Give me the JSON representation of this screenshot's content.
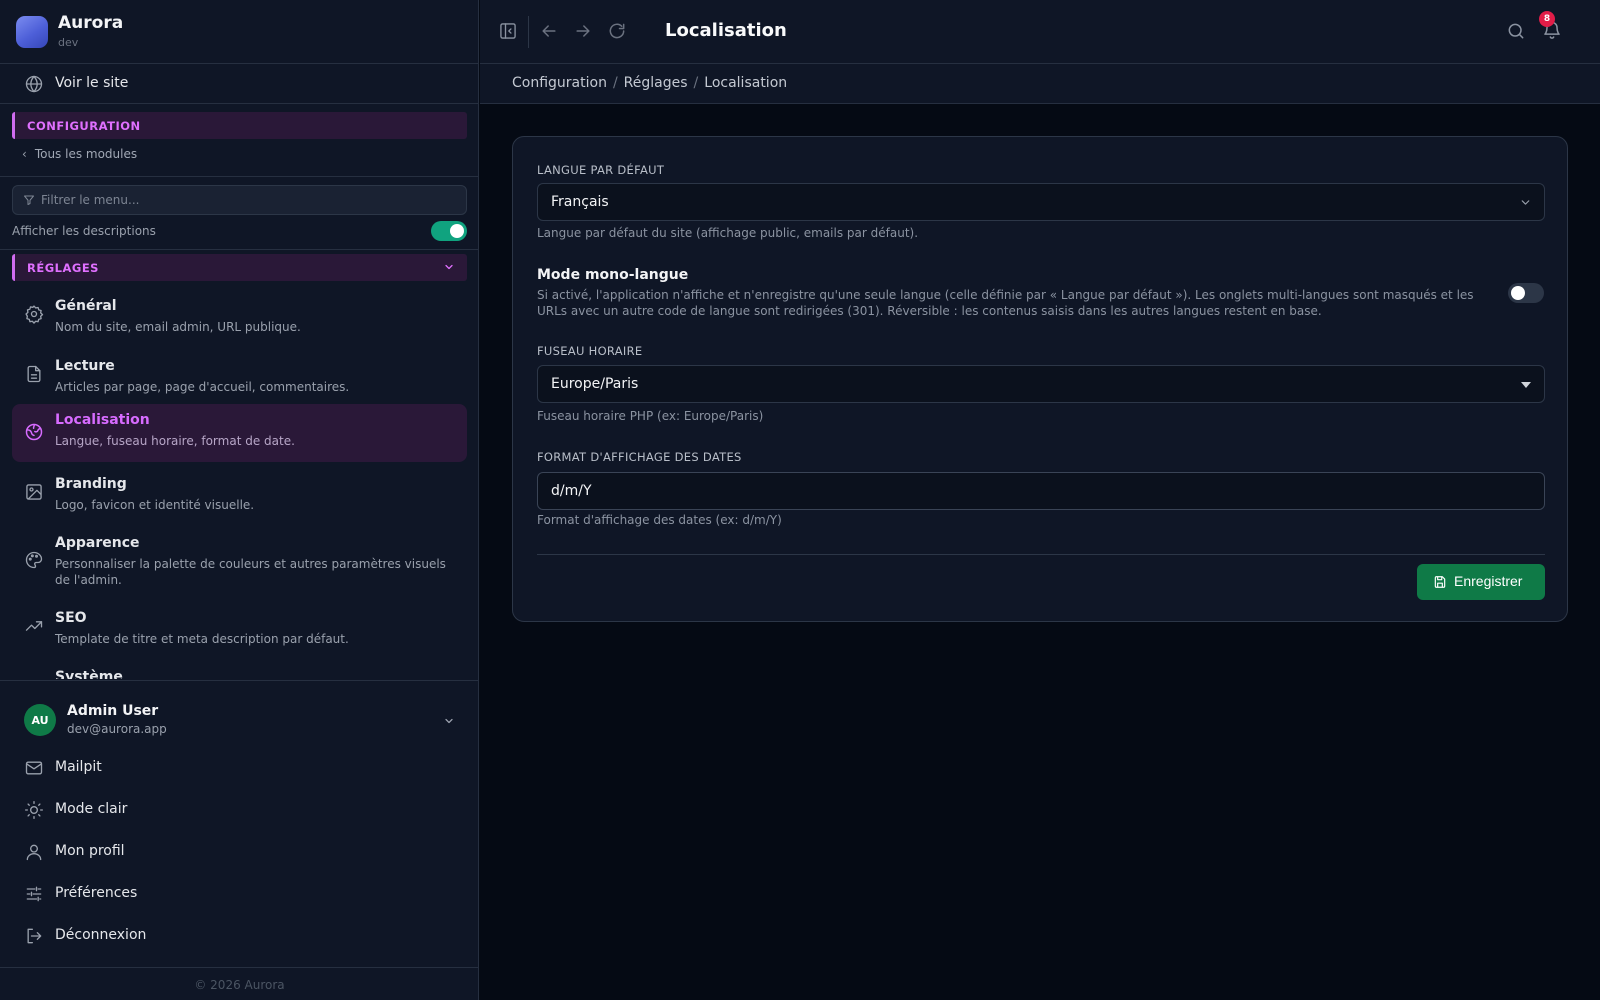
{
  "brand": {
    "name": "Aurora",
    "env": "dev"
  },
  "sidebar": {
    "view_site": "Voir le site",
    "section": "CONFIGURATION",
    "back": "Tous les modules",
    "filter_placeholder": "Filtrer le menu...",
    "show_descriptions_label": "Afficher les descriptions",
    "show_descriptions_on": true,
    "group": "RÉGLAGES",
    "items": [
      {
        "title": "Général",
        "desc": "Nom du site, email admin, URL publique.",
        "icon": "gear-icon"
      },
      {
        "title": "Lecture",
        "desc": "Articles par page, page d'accueil, commentaires.",
        "icon": "document-icon"
      },
      {
        "title": "Localisation",
        "desc": "Langue, fuseau horaire, format de date.",
        "icon": "globe-icon",
        "active": true
      },
      {
        "title": "Branding",
        "desc": "Logo, favicon et identité visuelle.",
        "icon": "image-icon"
      },
      {
        "title": "Apparence",
        "desc": "Personnaliser la palette de couleurs et autres paramètres visuels de l'admin.",
        "icon": "palette-icon"
      },
      {
        "title": "SEO",
        "desc": "Template de titre et meta description par défaut.",
        "icon": "trending-icon"
      },
      {
        "title": "Système",
        "desc": "",
        "icon": ""
      }
    ]
  },
  "user": {
    "initials": "AU",
    "name": "Admin User",
    "email": "dev@aurora.app"
  },
  "footer_links": [
    {
      "label": "Mailpit",
      "icon": "mail-icon"
    },
    {
      "label": "Mode clair",
      "icon": "sun-icon"
    },
    {
      "label": "Mon profil",
      "icon": "user-icon"
    },
    {
      "label": "Préférences",
      "icon": "sliders-icon"
    },
    {
      "label": "Déconnexion",
      "icon": "logout-icon"
    }
  ],
  "copyright": "© 2026 Aurora",
  "header": {
    "title": "Localisation",
    "notifications_count": "8"
  },
  "breadcrumb": [
    "Configuration",
    "Réglages",
    "Localisation"
  ],
  "form": {
    "default_language": {
      "label": "LANGUE PAR DÉFAUT",
      "value": "Français",
      "help": "Langue par défaut du site (affichage public, emails par défaut)."
    },
    "mono_language": {
      "title": "Mode mono-langue",
      "desc": "Si activé, l'application n'affiche et n'enregistre qu'une seule langue (celle définie par « Langue par défaut »). Les onglets multi-langues sont masqués et les URLs avec un autre code de langue sont redirigées (301). Réversible : les contenus saisis dans les autres langues restent en base.",
      "enabled": false
    },
    "timezone": {
      "label": "FUSEAU HORAIRE",
      "value": "Europe/Paris",
      "help": "Fuseau horaire PHP (ex: Europe/Paris)"
    },
    "date_format": {
      "label": "FORMAT D'AFFICHAGE DES DATES",
      "value": "d/m/Y",
      "help": "Format d'affichage des dates (ex: d/m/Y)"
    },
    "save_label": "Enregistrer"
  },
  "colors": {
    "accent": "#d76bff",
    "success": "#0f7a47",
    "toggle_on": "#10a37f",
    "badge": "#e11d48"
  }
}
